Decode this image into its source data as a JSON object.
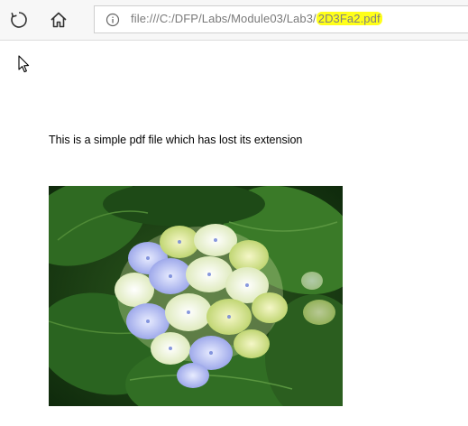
{
  "toolbar": {
    "refresh_icon": "refresh-icon",
    "home_icon": "home-icon"
  },
  "address_bar": {
    "info_icon": "info-icon",
    "url_prefix": "file:///C:/DFP/Labs/Module03/Lab3/",
    "url_highlighted": "2D3Fa2.pdf",
    "highlight_color": "#ffff1a"
  },
  "cursor": {
    "icon": "mouse-pointer-icon"
  },
  "document": {
    "text": "This is a simple pdf file which has lost its extension",
    "image": "hydrangea-flower-photo"
  }
}
